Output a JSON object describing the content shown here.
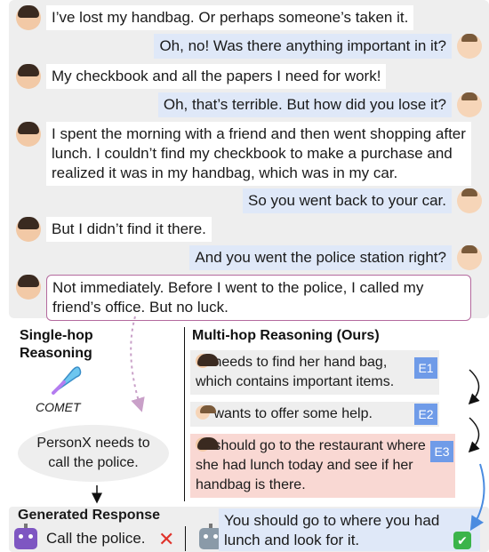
{
  "dialogue": [
    {
      "speaker": "female",
      "text": "I’ve lost my handbag. Or perhaps someone’s taken it."
    },
    {
      "speaker": "male",
      "text": "Oh, no! Was there anything important in it?"
    },
    {
      "speaker": "female",
      "text": "My checkbook and all the papers I need for work!"
    },
    {
      "speaker": "male",
      "text": "Oh, that’s terrible. But how did you lose it?"
    },
    {
      "speaker": "female",
      "text": "I spent the morning with a friend and then went shopping after lunch. I couldn’t find my checkbook to make a purchase and realized it was in my handbag, which was in my car."
    },
    {
      "speaker": "male",
      "text": "So you went back to your car."
    },
    {
      "speaker": "female",
      "text": "But I didn’t find it there."
    },
    {
      "speaker": "male",
      "text": "And you went the police station right?"
    },
    {
      "speaker": "female",
      "text": "Not immediately. Before I went to the police, I called my friend’s office. But no luck."
    }
  ],
  "single_hop": {
    "title": "Single-hop Reasoning",
    "tool": "COMET",
    "inference": "PersonX needs to call the police."
  },
  "multi_hop": {
    "title": "Multi-hop Reasoning (Ours)",
    "events": [
      {
        "tag": "E1",
        "text": "needs to find her hand bag, which contains important items."
      },
      {
        "tag": "E2",
        "text": "wants to offer some help."
      },
      {
        "tag": "E3",
        "text": "should go to the restaurant where she had lunch today and see if her handbag is there."
      }
    ]
  },
  "generated": {
    "title": "Generated Response",
    "baseline": "Call the police.",
    "ours": "You should go to where you had lunch and look for it."
  },
  "colors": {
    "panel_bg": "#eeeeee",
    "speaker_b_bubble": "#dfe8f8",
    "event_tag": "#6f9be8",
    "highlight_event": "#f9d8d3",
    "highlight_border": "#b46a9e",
    "cross": "#e0322a",
    "check": "#3bb44a",
    "blue_arrow": "#4a8be0"
  }
}
